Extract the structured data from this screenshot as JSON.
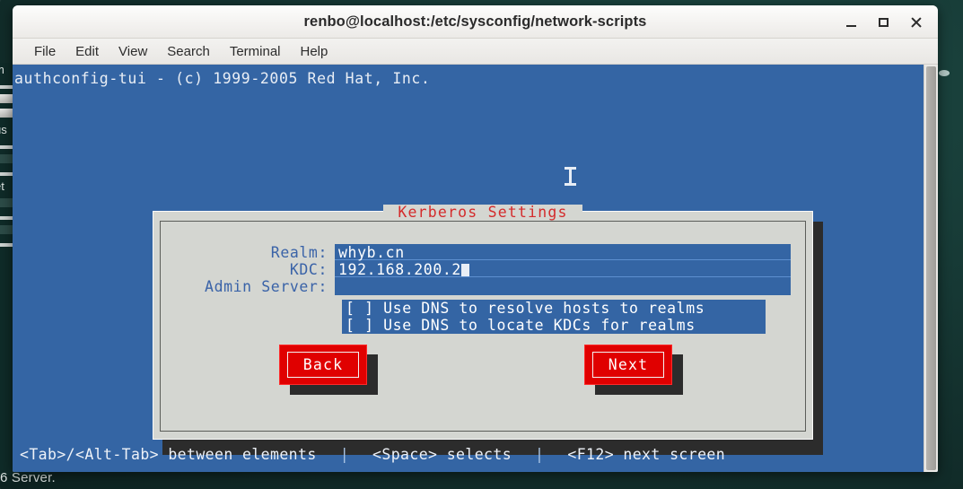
{
  "window": {
    "title": "renbo@localhost:/etc/sysconfig/network-scripts",
    "controls": {
      "minimize": "–",
      "maximize": "□",
      "close": "×"
    }
  },
  "menubar": {
    "items": [
      {
        "label": "File"
      },
      {
        "label": "Edit"
      },
      {
        "label": "View"
      },
      {
        "label": "Search"
      },
      {
        "label": "Terminal"
      },
      {
        "label": "Help"
      }
    ]
  },
  "terminal": {
    "header": "authconfig-tui - (c) 1999-2005 Red Hat, Inc.",
    "footer": {
      "hint1": "<Tab>/<Alt-Tab> between elements",
      "sep1": "|",
      "hint2": "<Space> selects",
      "sep2": "|",
      "hint3": "<F12> next screen"
    }
  },
  "dialog": {
    "title": "Kerberos Settings",
    "fields": [
      {
        "label": "Realm:",
        "value": "whyb.cn",
        "caret": false
      },
      {
        "label": "KDC:",
        "value": "192.168.200.2",
        "caret": true
      },
      {
        "label": "Admin Server:",
        "value": "",
        "caret": false
      }
    ],
    "checkboxes": [
      {
        "text": "[ ] Use DNS to resolve hosts to realms",
        "checked": false
      },
      {
        "text": "[ ] Use DNS to locate KDCs for realms",
        "checked": false
      }
    ],
    "buttons": [
      {
        "label": "Back"
      },
      {
        "label": "Next"
      }
    ]
  },
  "background": {
    "bottom_text": "6 Server.",
    "left_fragments": [
      "m",
      "us",
      "et"
    ]
  },
  "colors": {
    "terminal_blue": "#3465a4",
    "dialog_gray": "#d4d6d1",
    "title_red": "#d42b2b",
    "button_red": "#e00000",
    "label_blue": "#3a63a8",
    "shadow_dark": "#2c2c2c"
  }
}
